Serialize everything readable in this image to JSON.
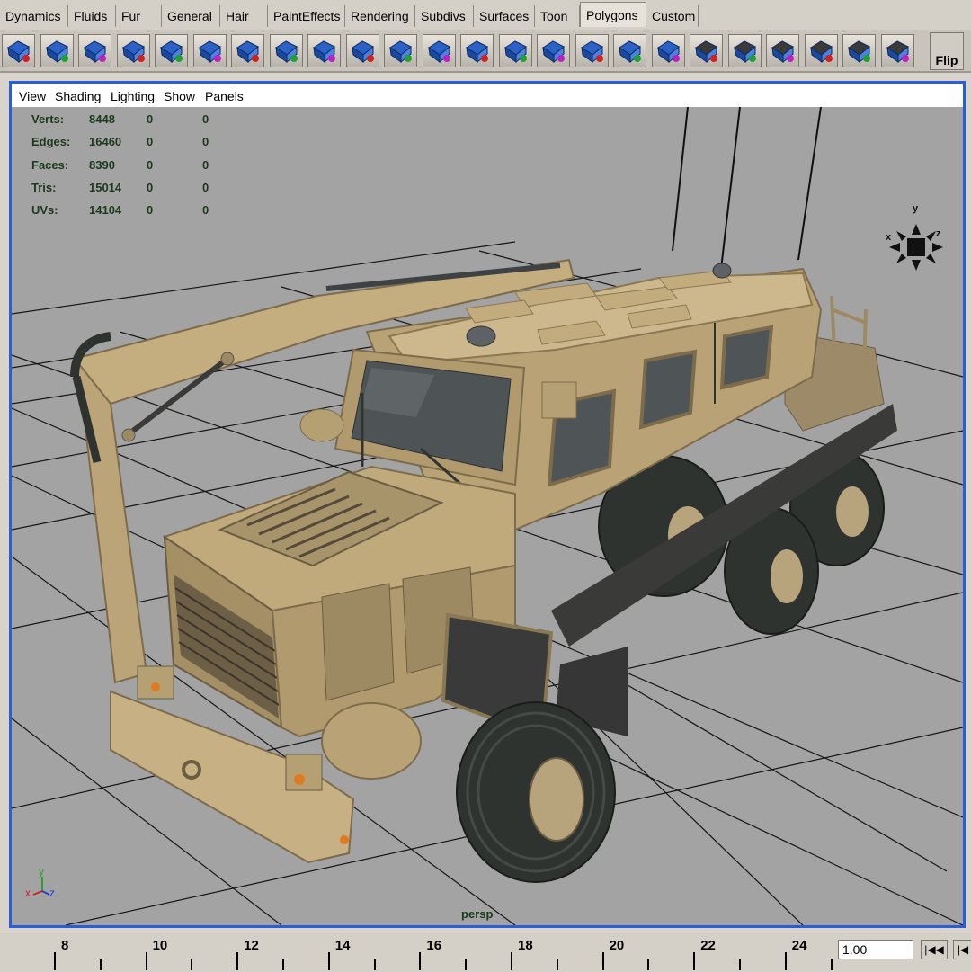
{
  "shelf_tabs": [
    {
      "label": "Dynamics",
      "active": false
    },
    {
      "label": "Fluids",
      "active": false
    },
    {
      "label": "Fur",
      "active": false
    },
    {
      "label": "General",
      "active": false
    },
    {
      "label": "Hair",
      "active": false
    },
    {
      "label": "PaintEffects",
      "active": false
    },
    {
      "label": "Rendering",
      "active": false
    },
    {
      "label": "Subdivs",
      "active": false
    },
    {
      "label": "Surfaces",
      "active": false
    },
    {
      "label": "Toon",
      "active": false
    },
    {
      "label": "Polygons",
      "active": true
    },
    {
      "label": "Custom",
      "active": false
    }
  ],
  "shelf": {
    "icons": [
      "sphere-select-icon",
      "extract-icon",
      "combine-icon",
      "poly-cube-icon",
      "smooth-icon",
      "extrude-face-icon",
      "split-polygon-icon",
      "bevel-icon",
      "wedge-icon",
      "poke-icon",
      "duplicate-face-icon",
      "append-polygon-icon",
      "subdivide-icon",
      "merge-vertices-icon",
      "cut-faces-icon",
      "triangulate-icon",
      "quadrangulate-icon",
      "move-uv-icon",
      "planar-map-icon",
      "automatic-map-icon",
      "cylindrical-map-icon",
      "spherical-map-icon",
      "uv-snapshot-icon",
      "uv-layout-icon"
    ],
    "flip_label": "Flip"
  },
  "viewport_menu": [
    "View",
    "Shading",
    "Lighting",
    "Show",
    "Panels"
  ],
  "hud": {
    "rows": [
      {
        "label": "Verts:",
        "v1": "8448",
        "v2": "0",
        "v3": "0"
      },
      {
        "label": "Edges:",
        "v1": "16460",
        "v2": "0",
        "v3": "0"
      },
      {
        "label": "Faces:",
        "v1": "8390",
        "v2": "0",
        "v3": "0"
      },
      {
        "label": "Tris:",
        "v1": "15014",
        "v2": "0",
        "v3": "0"
      },
      {
        "label": "UVs:",
        "v1": "14104",
        "v2": "0",
        "v3": "0"
      }
    ]
  },
  "view_cube": {
    "x": "x",
    "y": "y",
    "z": "z"
  },
  "axis_gizmo": {
    "x": "x",
    "y": "y",
    "z": "z"
  },
  "camera_label": "persp",
  "timeline": {
    "frames": [
      "8",
      "10",
      "12",
      "14",
      "16",
      "18",
      "20",
      "22",
      "24"
    ],
    "current_frame": "1.00"
  },
  "colors": {
    "active_panel_border": "#2c5cd8",
    "viewport_bg": "#a3a3a3",
    "vehicle_body": "#c2ac7e",
    "tire": "#2f3330"
  }
}
